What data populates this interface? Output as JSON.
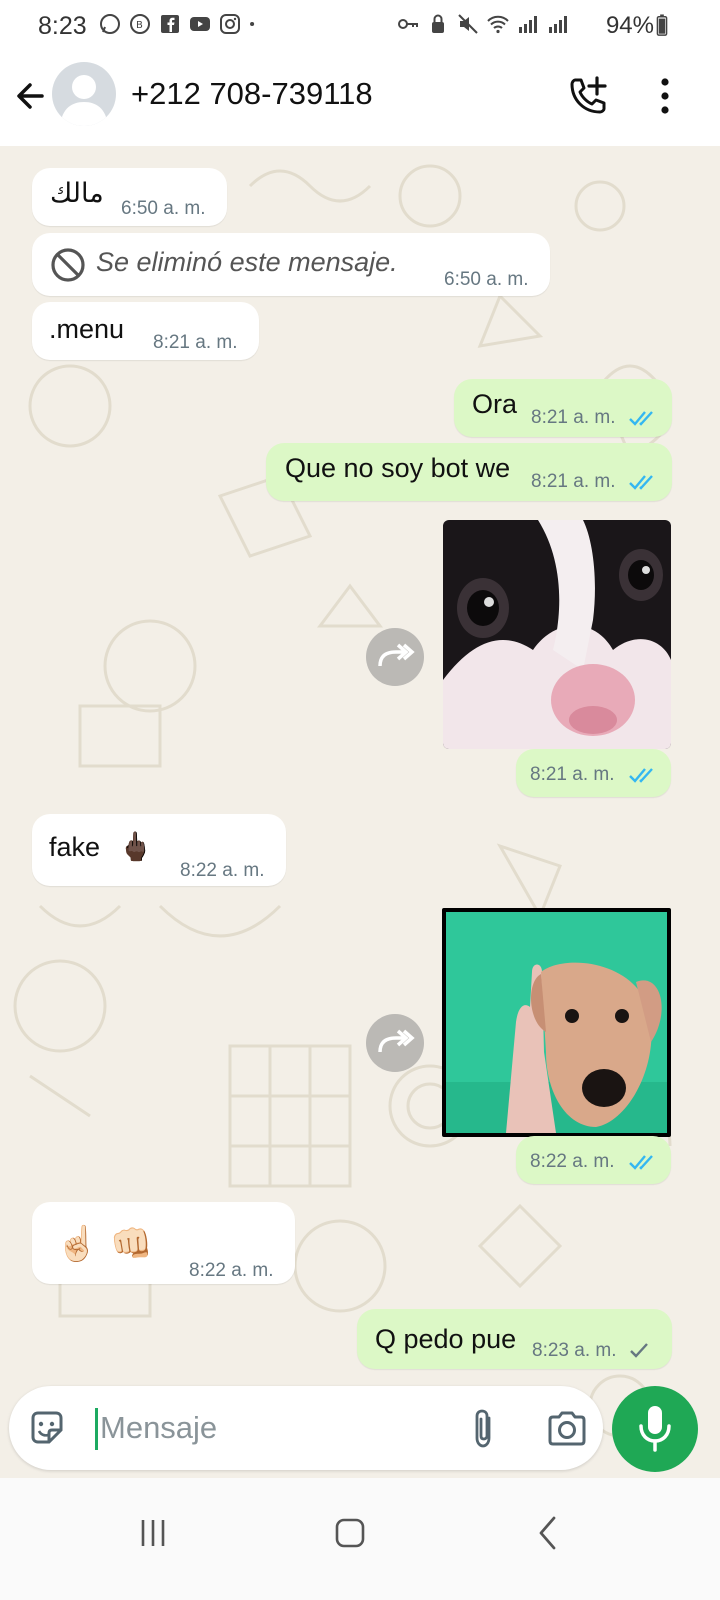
{
  "status": {
    "time": "8:23",
    "battery": "94%"
  },
  "header": {
    "contact": "+212 708-739118"
  },
  "messages": [
    {
      "dir": "in",
      "text": "مالك",
      "time": "6:50 a. m."
    },
    {
      "dir": "in",
      "text": "Se eliminó este mensaje.",
      "time": "6:50 a. m.",
      "deleted": true
    },
    {
      "dir": "in",
      "text": ".menu",
      "time": "8:21 a. m."
    },
    {
      "dir": "out",
      "text": "Ora",
      "time": "8:21 a. m.",
      "status": "read"
    },
    {
      "dir": "out",
      "text": "Que no soy bot we",
      "time": "8:21 a. m.",
      "status": "read"
    },
    {
      "dir": "out",
      "sticker": "cat-face",
      "time": "8:21 a. m.",
      "status": "read"
    },
    {
      "dir": "in",
      "text": "fake",
      "emoji": "🖕🏿",
      "time": "8:22 a. m."
    },
    {
      "dir": "out",
      "sticker": "dog-middle-finger",
      "time": "8:22 a. m.",
      "status": "read"
    },
    {
      "dir": "in",
      "emoji": "☝🏻👊🏻",
      "time": "8:22 a. m."
    },
    {
      "dir": "out",
      "text": "Q pedo pue",
      "time": "8:23 a. m.",
      "status": "sent"
    }
  ],
  "input": {
    "placeholder": "Mensaje"
  },
  "colors": {
    "outgoing_bubble": "#dcf8c6",
    "incoming_bubble": "#ffffff",
    "read_ticks": "#34b7f1",
    "accent": "#1fa855"
  }
}
